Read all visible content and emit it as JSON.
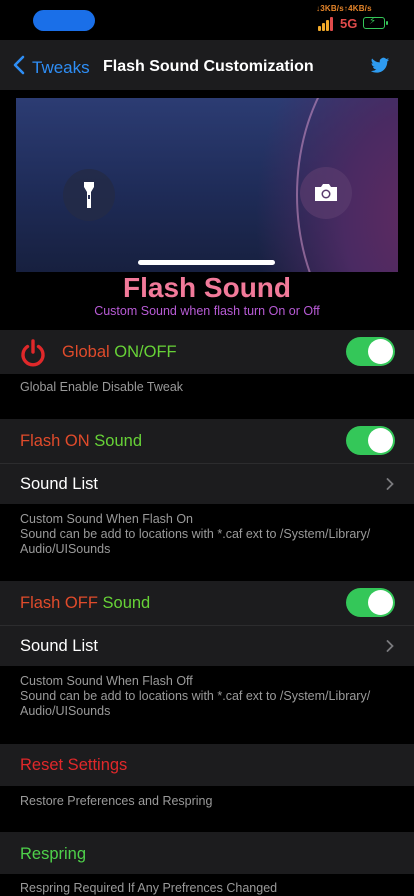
{
  "status": {
    "net_speed": "↓3KB/s↑4KB/s",
    "network": "5G"
  },
  "nav": {
    "back_label": "Tweaks",
    "title": "Flash Sound Customization"
  },
  "hero": {
    "title": "Flash Sound",
    "subtitle": "Custom Sound  when flash turn On or Off"
  },
  "global": {
    "label_part1": "Global ",
    "label_part2": "ON/OFF",
    "enabled": true,
    "footer": "Global Enable Disable Tweak"
  },
  "flash_on": {
    "label_part1": "Flash ON ",
    "label_part2": "Sound",
    "enabled": true,
    "list_label": "Sound List",
    "footer_line1": "Custom Sound When Flash On",
    "footer_line2": "Sound can be add to locations with *.caf ext to /System/Library/",
    "footer_line3": "Audio/UISounds"
  },
  "flash_off": {
    "label_part1": "Flash OFF ",
    "label_part2": "Sound",
    "enabled": true,
    "list_label": "Sound List",
    "footer_line1": "Custom Sound When Flash Off",
    "footer_line2": "Sound can be add to locations with *.caf ext to /System/Library/",
    "footer_line3": "Audio/UISounds"
  },
  "reset": {
    "label": "Reset Settings",
    "footer": "Restore Preferences and Respring"
  },
  "respring": {
    "label": "Respring",
    "footer": "Respring Required If Any Prefrences Changed"
  },
  "colors": {
    "accent_blue": "#2e8ef6",
    "toggle_green": "#34c759",
    "title_pink": "#f27a9a",
    "subtitle_purple": "#b85bd6",
    "red": "#e04b2b",
    "green": "#67d237"
  },
  "icons": [
    "back-chevron-icon",
    "twitter-icon",
    "flashlight-icon",
    "camera-icon",
    "power-icon",
    "chevron-right-icon"
  ]
}
